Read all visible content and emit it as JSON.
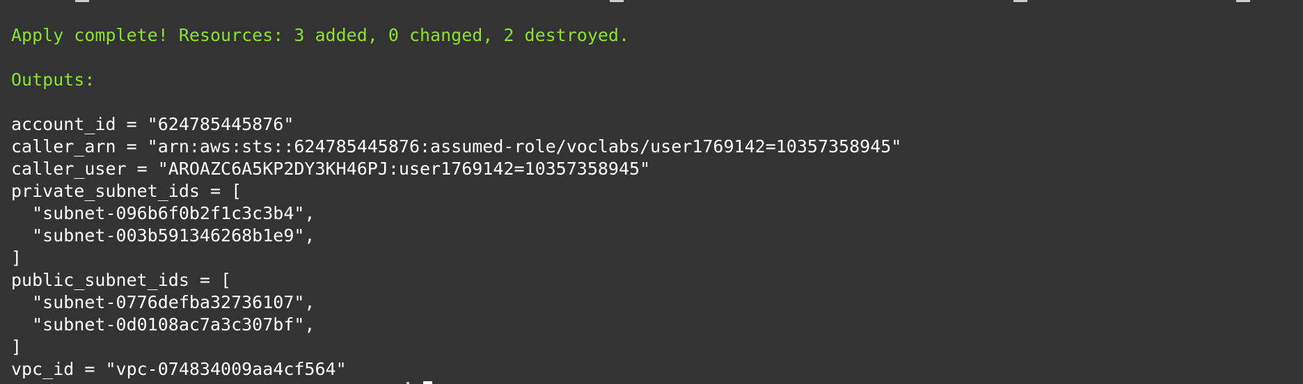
{
  "terminal": {
    "colors": {
      "background": "#333333",
      "text": "#ffffff",
      "success": "#8ae234"
    },
    "apply_message": "Apply complete! Resources: 3 added, 0 changed, 2 destroyed.",
    "outputs_header": "Outputs:",
    "outputs": {
      "account_id": "account_id = \"624785445876\"",
      "caller_arn": "caller_arn = \"arn:aws:sts::624785445876:assumed-role/voclabs/user1769142=10357358945\"",
      "caller_user": "caller_user = \"AROAZC6A5KP2DY3KH46PJ:user1769142=10357358945\"",
      "private_subnet_ids_open": "private_subnet_ids = [",
      "private_subnet_1": "  \"subnet-096b6f0b2f1c3c3b4\",",
      "private_subnet_2": "  \"subnet-003b591346268b1e9\",",
      "private_subnet_ids_close": "]",
      "public_subnet_ids_open": "public_subnet_ids = [",
      "public_subnet_1": "  \"subnet-0776defba32736107\",",
      "public_subnet_2": "  \"subnet-0d0108ac7a3c307bf\",",
      "public_subnet_ids_close": "]",
      "vpc_id": "vpc_id = \"vpc-074834009aa4cf564\""
    }
  }
}
